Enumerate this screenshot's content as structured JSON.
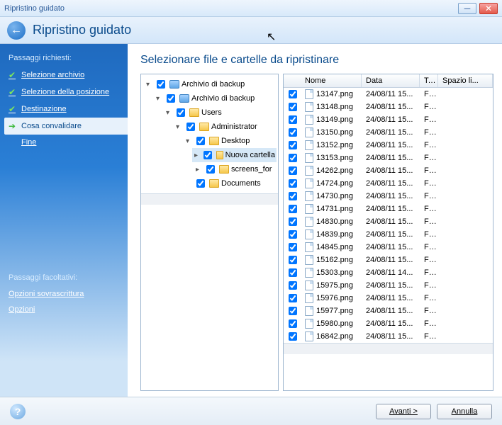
{
  "titlebar": {
    "title": "Ripristino guidato"
  },
  "header": {
    "title": "Ripristino guidato"
  },
  "sidebar": {
    "required_heading": "Passaggi richiesti:",
    "optional_heading": "Passaggi facoltativi:",
    "steps": [
      {
        "label": "Selezione archivio",
        "done": true
      },
      {
        "label": "Selezione della posizione",
        "done": true
      },
      {
        "label": "Destinazione",
        "done": true
      },
      {
        "label": "Cosa convalidare",
        "active": true
      },
      {
        "label": "Fine"
      }
    ],
    "optional": [
      {
        "label": "Opzioni sovrascrittura"
      },
      {
        "label": "Opzioni"
      }
    ]
  },
  "main": {
    "title": "Selezionare file e cartelle da ripristinare",
    "tree": [
      {
        "level": 0,
        "expanded": true,
        "icon": "archive",
        "label": "Archivio di backup"
      },
      {
        "level": 1,
        "expanded": true,
        "icon": "archive",
        "label": "Archivio di backup"
      },
      {
        "level": 2,
        "expanded": true,
        "icon": "folder",
        "label": "Users"
      },
      {
        "level": 3,
        "expanded": true,
        "icon": "folder",
        "label": "Administrator"
      },
      {
        "level": 4,
        "expanded": true,
        "icon": "folder",
        "label": "Desktop"
      },
      {
        "level": 5,
        "expanded": false,
        "icon": "folder",
        "label": "Nuova cartella",
        "selected": true
      },
      {
        "level": 5,
        "expanded": false,
        "icon": "folder",
        "label": "screens_for"
      },
      {
        "level": 4,
        "expanded": null,
        "icon": "folder",
        "label": "Documents"
      }
    ],
    "columns": {
      "cb": "",
      "name": "Nome",
      "date": "Data",
      "type": "T...",
      "size": "Spazio li..."
    },
    "files": [
      {
        "name": "13147.png",
        "date": "24/08/11 15...",
        "type": "Fil..."
      },
      {
        "name": "13148.png",
        "date": "24/08/11 15...",
        "type": "Fil..."
      },
      {
        "name": "13149.png",
        "date": "24/08/11 15...",
        "type": "Fil..."
      },
      {
        "name": "13150.png",
        "date": "24/08/11 15...",
        "type": "Fil..."
      },
      {
        "name": "13152.png",
        "date": "24/08/11 15...",
        "type": "Fil..."
      },
      {
        "name": "13153.png",
        "date": "24/08/11 15...",
        "type": "Fil..."
      },
      {
        "name": "14262.png",
        "date": "24/08/11 15...",
        "type": "Fil..."
      },
      {
        "name": "14724.png",
        "date": "24/08/11 15...",
        "type": "Fil..."
      },
      {
        "name": "14730.png",
        "date": "24/08/11 15...",
        "type": "Fil..."
      },
      {
        "name": "14731.png",
        "date": "24/08/11 15...",
        "type": "Fil..."
      },
      {
        "name": "14830.png",
        "date": "24/08/11 15...",
        "type": "Fil..."
      },
      {
        "name": "14839.png",
        "date": "24/08/11 15...",
        "type": "Fil..."
      },
      {
        "name": "14845.png",
        "date": "24/08/11 15...",
        "type": "Fil..."
      },
      {
        "name": "15162.png",
        "date": "24/08/11 15...",
        "type": "Fil..."
      },
      {
        "name": "15303.png",
        "date": "24/08/11 14...",
        "type": "Fil..."
      },
      {
        "name": "15975.png",
        "date": "24/08/11 15...",
        "type": "Fil..."
      },
      {
        "name": "15976.png",
        "date": "24/08/11 15...",
        "type": "Fil..."
      },
      {
        "name": "15977.png",
        "date": "24/08/11 15...",
        "type": "Fil..."
      },
      {
        "name": "15980.png",
        "date": "24/08/11 15...",
        "type": "Fil..."
      },
      {
        "name": "16842.png",
        "date": "24/08/11 15...",
        "type": "Fil..."
      }
    ]
  },
  "buttons": {
    "next": "Avanti >",
    "cancel": "Annulla"
  }
}
